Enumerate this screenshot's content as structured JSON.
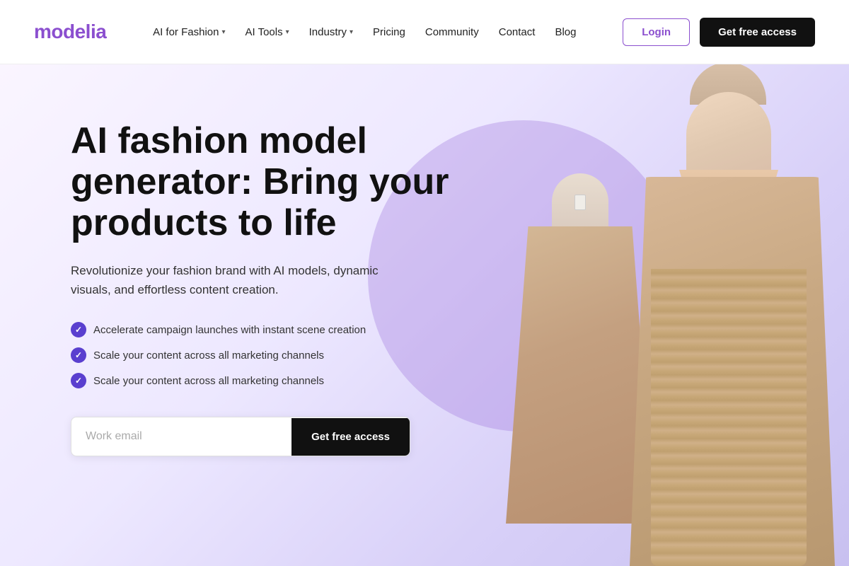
{
  "brand": {
    "name": "modelia",
    "color": "#8b4fcf"
  },
  "navbar": {
    "nav_items": [
      {
        "label": "AI for Fashion",
        "hasDropdown": true
      },
      {
        "label": "AI Tools",
        "hasDropdown": true
      },
      {
        "label": "Industry",
        "hasDropdown": true
      },
      {
        "label": "Pricing",
        "hasDropdown": false
      },
      {
        "label": "Community",
        "hasDropdown": false
      },
      {
        "label": "Contact",
        "hasDropdown": false
      },
      {
        "label": "Blog",
        "hasDropdown": false
      }
    ],
    "login_label": "Login",
    "cta_label": "Get free access"
  },
  "hero": {
    "title": "AI fashion model generator: Bring your products to life",
    "subtitle": "Revolutionize your fashion brand with AI models, dynamic visuals, and effortless content creation.",
    "features": [
      "Accelerate campaign launches with instant scene creation",
      "Scale your content across all marketing channels",
      "Scale your content across all marketing channels"
    ],
    "email_placeholder": "Work email",
    "cta_label": "Get free access"
  }
}
